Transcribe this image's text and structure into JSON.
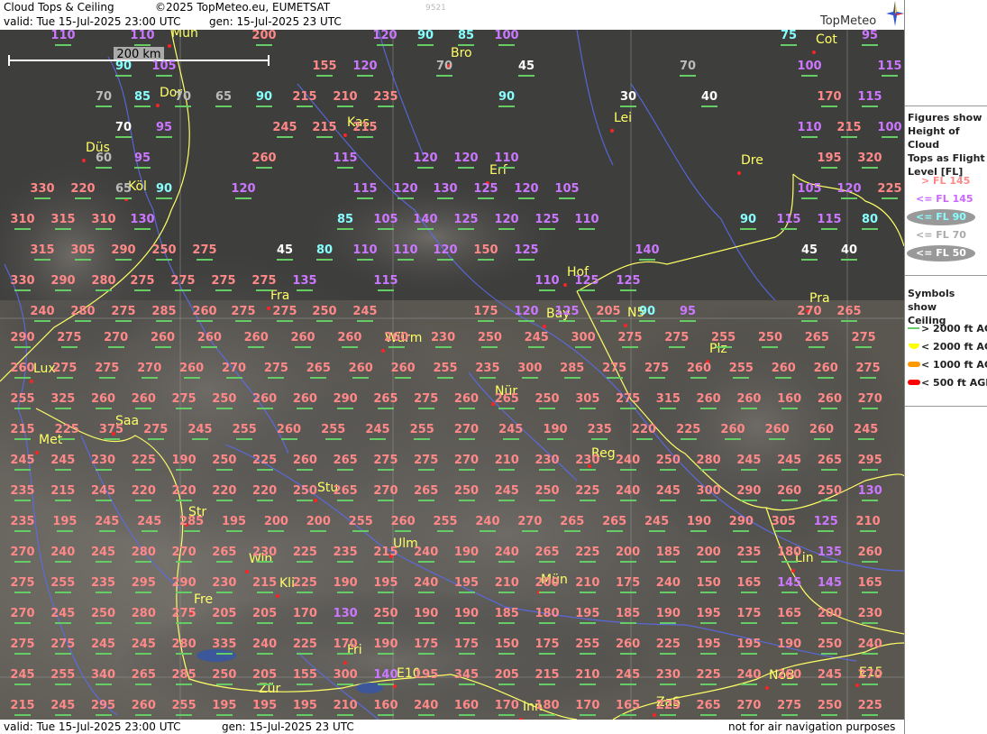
{
  "header": {
    "title": "Cloud Tops & Ceiling",
    "copyright": "©2025 TopMeteo.eu, EUMETSAT",
    "valid": "valid:  Tue  15-Jul-2025  23:00 UTC",
    "gen": "gen: 15-Jul-2025 23 UTC",
    "code": "9521",
    "logo": "TopMeteo"
  },
  "footer": {
    "valid": "valid:  Tue  15-Jul-2025  23:00 UTC",
    "gen": "gen: 15-Jul-2025 23 UTC",
    "note": "not for air navigation purposes"
  },
  "scale": {
    "label": "200 km"
  },
  "legend": {
    "heading1": [
      "Figures show",
      "Height of Cloud",
      "Tops as Flight",
      "Level  [FL]"
    ],
    "fl_items": [
      {
        "label": "> FL 145",
        "color": "#ff8888"
      },
      {
        "label": "<= FL 145",
        "color": "#cc66ff"
      },
      {
        "label": "<= FL 90",
        "color": "#88ffff",
        "bg": "#999999"
      },
      {
        "label": "<= FL 70",
        "color": "#aaaaaa"
      },
      {
        "label": "<= FL 50",
        "color": "#ffffff",
        "bg": "#999999"
      }
    ],
    "heading2": [
      "Symbols show",
      "Ceiling"
    ],
    "ceiling_items": [
      {
        "label": "> 2000 ft AGL",
        "color": "#66cc66",
        "symbol": "line"
      },
      {
        "label": "< 2000 ft AGL",
        "color": "#ffff00",
        "symbol": "half"
      },
      {
        "label": "< 1000 ft AGL",
        "color": "#ff9900",
        "symbol": "pill"
      },
      {
        "label": "< 500 ft AGL",
        "color": "#ff0000",
        "symbol": "pill"
      }
    ]
  },
  "colors": {
    "high": "#ff8888",
    "mid": "#cc77ff",
    "low90": "#88ffff",
    "low70": "#bbbbbb",
    "low50": "#ffffff",
    "city": "#ffff66",
    "border": "#ffff66",
    "river": "#5566ff"
  },
  "cities": [
    "Mün",
    "Bro",
    "Cot",
    "Dor",
    "Kas",
    "Lei",
    "Düs",
    "Erf",
    "Dre",
    "Köl",
    "Hof",
    "Fra",
    "Bay",
    "N5",
    "Pra",
    "Würm",
    "Plz",
    "Lux",
    "Nür",
    "Saa",
    "Met",
    "Reg",
    "Stu",
    "Str",
    "Ulm",
    "Win",
    "Kli",
    "Mün",
    "Lin",
    "Fre",
    "Fri",
    "E10",
    "NöB",
    "E15",
    "Zür",
    "Inn",
    "ZaS"
  ],
  "values": [
    {
      "v": "110",
      "c": "mid"
    },
    {
      "v": "110",
      "c": "mid"
    },
    {
      "v": "200",
      "c": "high"
    },
    {
      "v": "120",
      "c": "mid"
    },
    {
      "v": "90",
      "c": "low90"
    },
    {
      "v": "85",
      "c": "low90"
    },
    {
      "v": "100",
      "c": "mid"
    },
    {
      "v": "75",
      "c": "low90"
    },
    {
      "v": "95",
      "c": "mid"
    },
    {
      "v": "90",
      "c": "low90"
    },
    {
      "v": "105",
      "c": "mid"
    },
    {
      "v": "155",
      "c": "high"
    },
    {
      "v": "120",
      "c": "mid"
    },
    {
      "v": "70",
      "c": "low70"
    },
    {
      "v": "45",
      "c": "low50"
    },
    {
      "v": "70",
      "c": "low70"
    },
    {
      "v": "100",
      "c": "mid"
    },
    {
      "v": "115",
      "c": "mid"
    },
    {
      "v": "70",
      "c": "low70"
    },
    {
      "v": "85",
      "c": "low90"
    },
    {
      "v": "70",
      "c": "low70"
    },
    {
      "v": "65",
      "c": "low70"
    },
    {
      "v": "90",
      "c": "low90"
    },
    {
      "v": "215",
      "c": "high"
    },
    {
      "v": "210",
      "c": "high"
    },
    {
      "v": "235",
      "c": "high"
    },
    {
      "v": "90",
      "c": "low90"
    },
    {
      "v": "30",
      "c": "low50"
    },
    {
      "v": "40",
      "c": "low50"
    },
    {
      "v": "170",
      "c": "high"
    },
    {
      "v": "115",
      "c": "mid"
    },
    {
      "v": "70",
      "c": "low50"
    },
    {
      "v": "95",
      "c": "mid"
    },
    {
      "v": "245",
      "c": "high"
    },
    {
      "v": "215",
      "c": "high"
    },
    {
      "v": "215",
      "c": "high"
    },
    {
      "v": "110",
      "c": "mid"
    },
    {
      "v": "215",
      "c": "high"
    },
    {
      "v": "100",
      "c": "mid"
    },
    {
      "v": "60",
      "c": "low70"
    },
    {
      "v": "95",
      "c": "mid"
    },
    {
      "v": "260",
      "c": "high"
    },
    {
      "v": "115",
      "c": "mid"
    },
    {
      "v": "120",
      "c": "mid"
    },
    {
      "v": "120",
      "c": "mid"
    },
    {
      "v": "110",
      "c": "mid"
    },
    {
      "v": "195",
      "c": "high"
    },
    {
      "v": "320",
      "c": "high"
    },
    {
      "v": "330",
      "c": "high"
    },
    {
      "v": "220",
      "c": "high"
    },
    {
      "v": "65",
      "c": "low70"
    },
    {
      "v": "90",
      "c": "low90"
    },
    {
      "v": "120",
      "c": "mid"
    },
    {
      "v": "115",
      "c": "mid"
    },
    {
      "v": "120",
      "c": "mid"
    },
    {
      "v": "130",
      "c": "mid"
    },
    {
      "v": "125",
      "c": "mid"
    },
    {
      "v": "120",
      "c": "mid"
    },
    {
      "v": "105",
      "c": "mid"
    },
    {
      "v": "105",
      "c": "mid"
    },
    {
      "v": "120",
      "c": "mid"
    },
    {
      "v": "225",
      "c": "high"
    },
    {
      "v": "310",
      "c": "high"
    },
    {
      "v": "315",
      "c": "high"
    },
    {
      "v": "310",
      "c": "high"
    },
    {
      "v": "130",
      "c": "mid"
    },
    {
      "v": "85",
      "c": "low90"
    },
    {
      "v": "105",
      "c": "mid"
    },
    {
      "v": "140",
      "c": "mid"
    },
    {
      "v": "125",
      "c": "mid"
    },
    {
      "v": "120",
      "c": "mid"
    },
    {
      "v": "125",
      "c": "mid"
    },
    {
      "v": "110",
      "c": "mid"
    },
    {
      "v": "90",
      "c": "low90"
    },
    {
      "v": "115",
      "c": "mid"
    },
    {
      "v": "115",
      "c": "mid"
    },
    {
      "v": "80",
      "c": "low90"
    },
    {
      "v": "315",
      "c": "high"
    },
    {
      "v": "305",
      "c": "high"
    },
    {
      "v": "290",
      "c": "high"
    },
    {
      "v": "250",
      "c": "high"
    },
    {
      "v": "275",
      "c": "high"
    },
    {
      "v": "45",
      "c": "low50"
    },
    {
      "v": "80",
      "c": "low90"
    },
    {
      "v": "110",
      "c": "mid"
    },
    {
      "v": "110",
      "c": "mid"
    },
    {
      "v": "120",
      "c": "mid"
    },
    {
      "v": "150",
      "c": "high"
    },
    {
      "v": "125",
      "c": "mid"
    },
    {
      "v": "140",
      "c": "mid"
    },
    {
      "v": "45",
      "c": "low50"
    },
    {
      "v": "40",
      "c": "low50"
    },
    {
      "v": "330",
      "c": "high"
    },
    {
      "v": "290",
      "c": "high"
    },
    {
      "v": "280",
      "c": "high"
    },
    {
      "v": "275",
      "c": "high"
    },
    {
      "v": "275",
      "c": "high"
    },
    {
      "v": "275",
      "c": "high"
    },
    {
      "v": "275",
      "c": "high"
    },
    {
      "v": "135",
      "c": "mid"
    },
    {
      "v": "115",
      "c": "mid"
    },
    {
      "v": "110",
      "c": "mid"
    },
    {
      "v": "125",
      "c": "mid"
    },
    {
      "v": "125",
      "c": "mid"
    },
    {
      "v": "240",
      "c": "high"
    },
    {
      "v": "280",
      "c": "high"
    },
    {
      "v": "275",
      "c": "high"
    },
    {
      "v": "285",
      "c": "high"
    },
    {
      "v": "260",
      "c": "high"
    },
    {
      "v": "275",
      "c": "high"
    },
    {
      "v": "275",
      "c": "high"
    },
    {
      "v": "250",
      "c": "high"
    },
    {
      "v": "245",
      "c": "high"
    },
    {
      "v": "175",
      "c": "high"
    },
    {
      "v": "120",
      "c": "mid"
    },
    {
      "v": "125",
      "c": "mid"
    },
    {
      "v": "205",
      "c": "high"
    },
    {
      "v": "90",
      "c": "low90"
    },
    {
      "v": "95",
      "c": "mid"
    },
    {
      "v": "270",
      "c": "high"
    },
    {
      "v": "265",
      "c": "high"
    }
  ]
}
